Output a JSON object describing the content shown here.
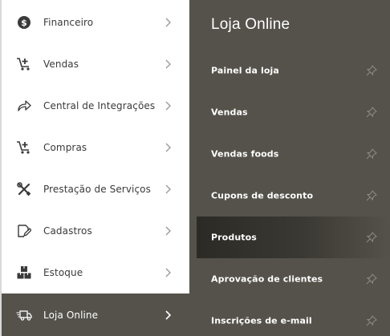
{
  "sidebar": {
    "items": [
      {
        "label": "Financeiro",
        "icon": "dollar-icon"
      },
      {
        "label": "Vendas",
        "icon": "cart-add-icon"
      },
      {
        "label": "Central de Integrações",
        "icon": "share-icon"
      },
      {
        "label": "Compras",
        "icon": "cart-add-icon"
      },
      {
        "label": "Prestação de Serviços",
        "icon": "tools-icon"
      },
      {
        "label": "Cadastros",
        "icon": "edit-icon"
      },
      {
        "label": "Estoque",
        "icon": "boxes-icon"
      },
      {
        "label": "Loja Online",
        "icon": "delivery-truck-icon",
        "active": true
      }
    ]
  },
  "submenu": {
    "title": "Loja Online",
    "items": [
      {
        "label": "Painel da loja"
      },
      {
        "label": "Vendas"
      },
      {
        "label": "Vendas foods"
      },
      {
        "label": "Cupons de desconto"
      },
      {
        "label": "Produtos",
        "selected": true
      },
      {
        "label": "Aprovação de clientes"
      },
      {
        "label": "Inscrições de e-mail"
      }
    ]
  },
  "colors": {
    "panel_bg": "#55524b",
    "sidebar_bg": "#ffffff",
    "text_dark": "#3a3a3a",
    "icon_gray": "#9a9a9a"
  }
}
